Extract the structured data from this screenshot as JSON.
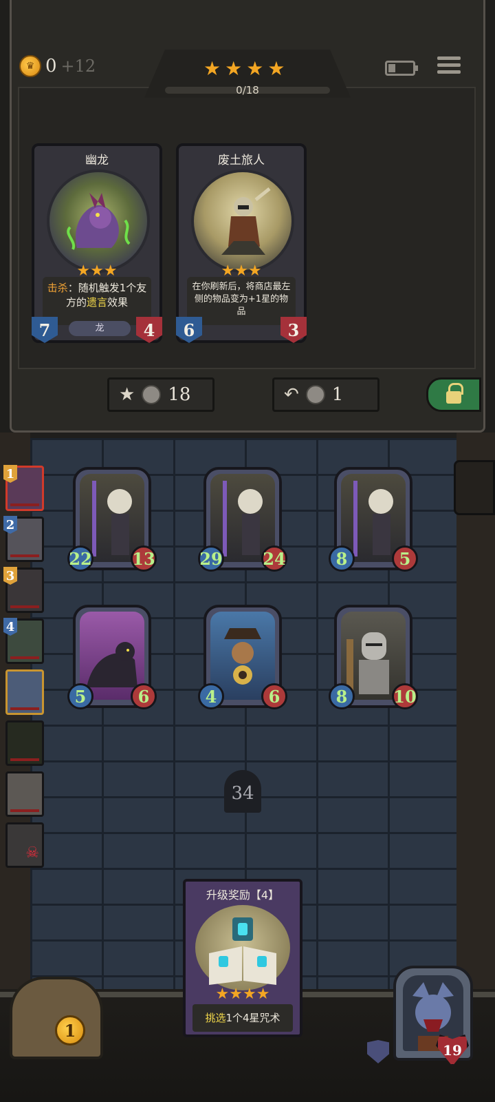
{
  "header": {
    "gold": "0",
    "gold_income": "+12",
    "tier_stars": 4,
    "progress_text": "0/18",
    "progress": 0.0
  },
  "shop": {
    "cards": [
      {
        "name": "幽龙",
        "stars": 3,
        "desc_prefix": "击杀",
        "desc_mid": "：随机触发1个友方的",
        "desc_keyword": "遗言",
        "desc_suffix": "效果",
        "attack": "7",
        "health": "4",
        "tribe": "龙"
      },
      {
        "name": "废土旅人",
        "stars": 3,
        "desc": "在你刷新后，将商店最左侧的物品变为+1星的物品",
        "attack": "6",
        "health": "3",
        "tribe": ""
      }
    ],
    "upgrade_cost": "18",
    "refresh_cost": "1"
  },
  "board": {
    "units": [
      {
        "attack": "22",
        "health": "13"
      },
      {
        "attack": "29",
        "health": "24"
      },
      {
        "attack": "8",
        "health": "5"
      },
      {
        "attack": "5",
        "health": "6"
      },
      {
        "attack": "4",
        "health": "6"
      },
      {
        "attack": "8",
        "health": "10"
      }
    ],
    "turn": "34"
  },
  "roster": {
    "numbers": [
      "1",
      "2",
      "3",
      "4"
    ]
  },
  "reward": {
    "title": "升级奖励【4】",
    "stars": 4,
    "desc_prefix": "挑选",
    "desc_rest": "1个4星咒术"
  },
  "player": {
    "chest_coin": "1",
    "health": "19"
  },
  "colors": {
    "star": "#f3a623",
    "attack": "#2f5b93",
    "health": "#a5313a",
    "board_stat_text": "#b9f08a"
  }
}
